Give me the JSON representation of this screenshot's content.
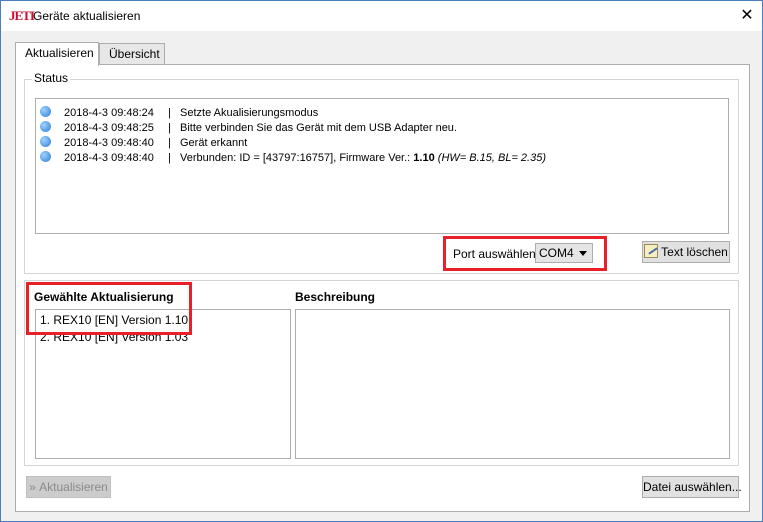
{
  "window": {
    "title": "Geräte aktualisieren",
    "logo_text": "JETI",
    "close_glyph": "✕"
  },
  "tabs": [
    {
      "label": "Aktualisieren",
      "active": true
    },
    {
      "label": "Übersicht",
      "active": false
    }
  ],
  "status": {
    "group_label": "Status",
    "log": [
      {
        "time": "2018-4-3 09:48:24",
        "sep": "|",
        "message": "Setzte Akualisierungsmodus"
      },
      {
        "time": "2018-4-3 09:48:25",
        "sep": "|",
        "message": "Bitte verbinden Sie das Gerät mit dem USB Adapter neu."
      },
      {
        "time": "2018-4-3 09:48:40",
        "sep": "|",
        "message": "Gerät erkannt"
      },
      {
        "time": "2018-4-3 09:48:40",
        "sep": "|",
        "message_prefix": "Verbunden: ID = [43797:16757], Firmware Ver.: ",
        "message_bold": "1.10",
        "message_italic": "(HW= B.15, BL= 2.35)"
      }
    ],
    "port_label": "Port auswählen:",
    "port_value": "COM4",
    "clear_button": "Text löschen"
  },
  "update": {
    "selected_heading": "Gewählte Aktualisierung",
    "description_heading": "Beschreibung",
    "items": [
      {
        "label": "1. REX10 [EN] Version  1.10",
        "selected": true
      },
      {
        "label": "2. REX10 [EN] Version  1.03",
        "selected": false
      }
    ],
    "description_text": ""
  },
  "footer": {
    "update_button": "Aktualisieren",
    "update_button_glyph": "»",
    "choose_file_button": "Datei auswählen..."
  },
  "colors": {
    "highlight_frame": "#e8202a",
    "logo": "#c8102e",
    "window_border": "#4a7ebb"
  },
  "icons": {
    "info": "info-icon",
    "clear": "pencil-icon",
    "dropdown": "chevron-down-icon",
    "close": "close-icon"
  }
}
